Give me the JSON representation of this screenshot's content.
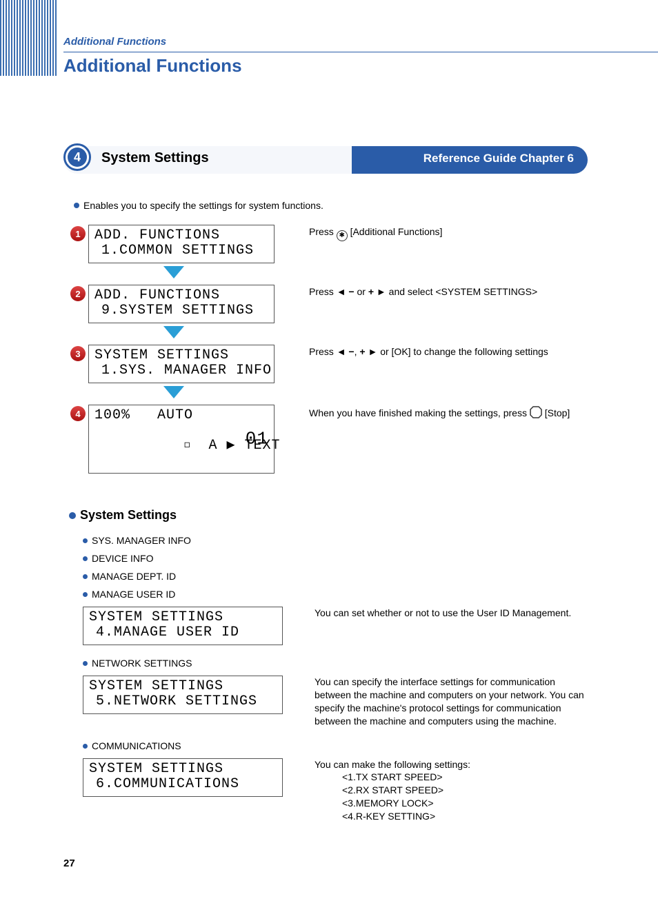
{
  "header": {
    "breadcrumb": "Additional Functions",
    "title": "Additional Functions"
  },
  "section": {
    "number": "4",
    "title": "System Settings",
    "reference": "Reference Guide Chapter 6",
    "intro": "Enables you to specify the settings for system functions."
  },
  "steps": [
    {
      "badge": "1",
      "lcd_line1": "ADD. FUNCTIONS",
      "lcd_line2": "1.COMMON SETTINGS",
      "desc_pre": "Press ",
      "desc_post": " [Additional Functions]"
    },
    {
      "badge": "2",
      "lcd_line1": "ADD. FUNCTIONS",
      "lcd_line2": "9.SYSTEM SETTINGS",
      "desc_pre": "Press ",
      "desc_mid": " or ",
      "desc_post": " and select <SYSTEM SETTINGS>"
    },
    {
      "badge": "3",
      "lcd_line1": "SYSTEM SETTINGS",
      "lcd_line2": "1.SYS. MANAGER INFO",
      "desc_pre": "Press ",
      "desc_mid": ", ",
      "desc_post": " or [OK] to change the following settings"
    },
    {
      "badge": "4",
      "lcd_line1": "100%   AUTO",
      "lcd_line2_a": "  A ",
      "lcd_line2_b": " TEXT",
      "lcd_right": "01",
      "desc_pre": "When you have finished making the settings, press ",
      "desc_post": " [Stop]"
    }
  ],
  "settings": {
    "heading": "System Settings",
    "items_simple": [
      "SYS. MANAGER INFO",
      "DEVICE INFO",
      "MANAGE DEPT. ID"
    ],
    "manage_user": {
      "label": "MANAGE USER ID",
      "lcd1": "SYSTEM SETTINGS",
      "lcd2": "4.MANAGE USER ID",
      "desc": "You can set whether or not to use the User ID Management."
    },
    "network": {
      "label": "NETWORK SETTINGS",
      "lcd1": "SYSTEM SETTINGS",
      "lcd2": "5.NETWORK SETTINGS",
      "desc": "You can specify the interface settings for communication between the machine and computers on your network. You can specify the machine's protocol settings for communication between the machine and computers using the machine."
    },
    "comm": {
      "label": "COMMUNICATIONS",
      "lcd1": "SYSTEM SETTINGS",
      "lcd2": "6.COMMUNICATIONS",
      "desc": "You can make the following settings:",
      "list": [
        "<1.TX START SPEED>",
        "<2.RX START SPEED>",
        "<3.MEMORY LOCK>",
        "<4.R-KEY SETTING>"
      ]
    }
  },
  "page_number": "27"
}
